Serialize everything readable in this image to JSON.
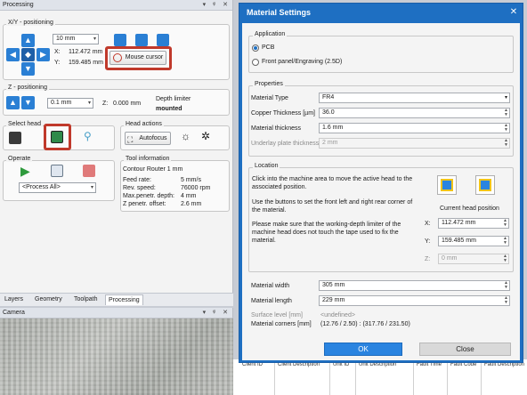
{
  "processing_panel": {
    "title": "Processing",
    "title_controls": "▾ ᵠ ✕",
    "xy": {
      "label": "X/Y - positioning",
      "step": "10 mm",
      "x_label": "X:",
      "x_value": "112.472 mm",
      "y_label": "Y:",
      "y_value": "159.485 mm",
      "mouse_cursor_label": "Mouse cursor"
    },
    "z": {
      "label": "Z - positioning",
      "step": "0.1 mm",
      "z_label": "Z:",
      "z_value": "0.000 mm",
      "depth_limiter_label": "Depth limiter",
      "depth_limiter_value": "mounted"
    },
    "select_head": {
      "label": "Select head"
    },
    "head_actions": {
      "label": "Head actions",
      "autofocus_label": "Autofocus"
    },
    "operate": {
      "label": "Operate",
      "process_select": "<Process All>"
    },
    "tool_info": {
      "label": "Tool information",
      "tool_name": "Contour Router 1 mm",
      "rows": [
        {
          "key": "Feed rate:",
          "value": "5 mm/s"
        },
        {
          "key": "Rev. speed:",
          "value": "76000 rpm"
        },
        {
          "key": "Max.penetr. depth:",
          "value": "4 mm"
        },
        {
          "key": "Z penetr. offset:",
          "value": "2.6 mm"
        }
      ]
    },
    "tabs": [
      "Layers",
      "Geometry",
      "Toolpath",
      "Processing"
    ]
  },
  "camera_panel": {
    "title": "Camera",
    "title_controls": "▾ ᵠ ✕"
  },
  "background_table": {
    "columns": [
      "Client ID",
      "Client Description",
      "Unit ID",
      "Unit Description",
      "Fault Time",
      "Fault Code",
      "Fault Description"
    ]
  },
  "dialog": {
    "title": "Material Settings",
    "close_glyph": "✕",
    "application": {
      "label": "Application",
      "options": [
        "PCB",
        "Front panel/Engraving (2.5D)"
      ],
      "selected": "PCB"
    },
    "properties": {
      "label": "Properties",
      "material_type_label": "Material Type",
      "material_type_value": "FR4",
      "copper_label": "Copper Thickness [µm]",
      "copper_value": "36.0",
      "material_thickness_label": "Material thickness",
      "material_thickness_value": "1.6 mm",
      "underlay_label": "Underlay plate thickness",
      "underlay_value": "2 mm"
    },
    "location": {
      "label": "Location",
      "text1": "Click into the machine area to move the active head to the associated position.",
      "text2": "Use the buttons to set the front left and right rear corner of the material.",
      "text3": "Please make sure that the working-depth limiter of the machine head does not touch the tape used to fix the material.",
      "current_head_label": "Current head position",
      "x_label": "X:",
      "x_value": "112.472 mm",
      "y_label": "Y:",
      "y_value": "159.485 mm",
      "z_label": "Z:",
      "z_value": "0 mm"
    },
    "dimensions": {
      "width_label": "Material width",
      "width_value": "305 mm",
      "length_label": "Material length",
      "length_value": "229 mm",
      "surface_label": "Surface level [mm]",
      "surface_value": "<undefined>",
      "corners_label": "Material corners [mm]",
      "corners_value": "(12.76 / 2.50) : (317.76 / 231.50)"
    },
    "ok_label": "OK",
    "close_label": "Close"
  },
  "colors": {
    "accent": "#1e6fc2",
    "highlight": "#c0392b"
  }
}
